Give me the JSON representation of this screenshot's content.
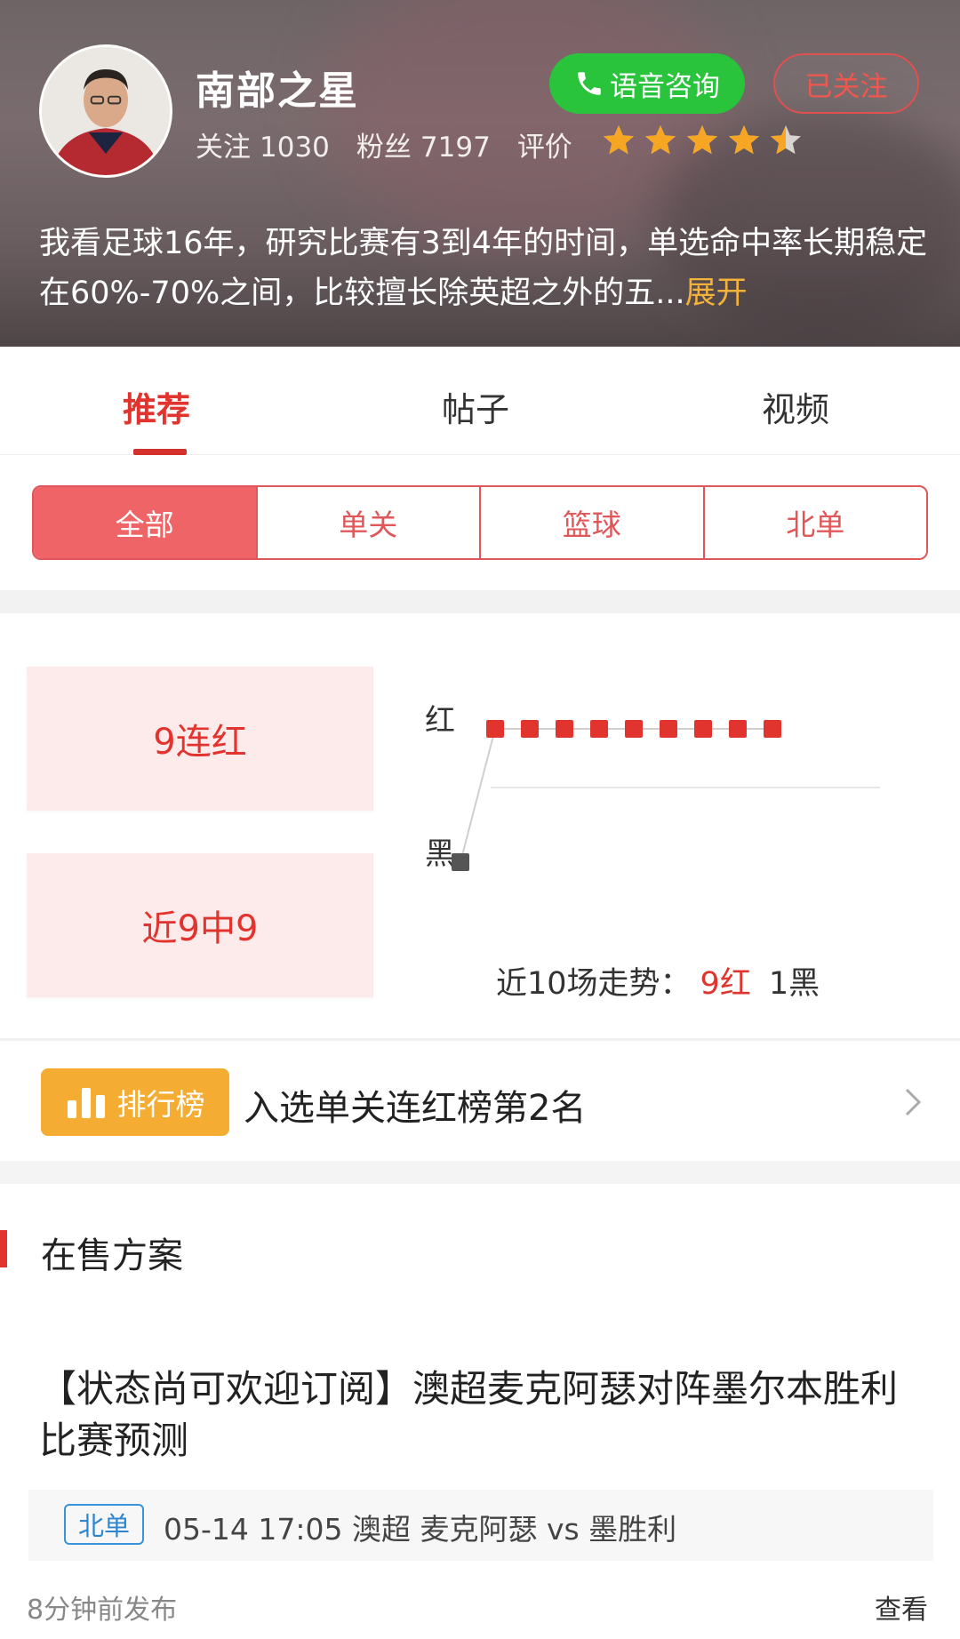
{
  "profile": {
    "name": "南部之星",
    "follow_label": "关注",
    "follow_count": "1030",
    "fans_label": "粉丝",
    "fans_count": "7197",
    "rating_label": "评价",
    "rating": 4.5,
    "voice_button": "语音咨询",
    "followed_button": "已关注",
    "bio": "我看足球16年，研究比赛有3到4年的时间，单选命中率长期稳定在60%-70%之间，比较擅长除英超之外的五...",
    "expand": "展开"
  },
  "tabs": [
    "推荐",
    "帖子",
    "视频"
  ],
  "filters": [
    "全部",
    "单关",
    "篮球",
    "北单"
  ],
  "stats": {
    "streak": "9连红",
    "recent": "近9中9",
    "label_red": "红",
    "label_black": "黑",
    "trend_prefix": "近10场走势：",
    "trend_red": "9红",
    "trend_black": "1黑"
  },
  "chart_data": {
    "type": "line",
    "x": [
      1,
      2,
      3,
      4,
      5,
      6,
      7,
      8,
      9,
      10
    ],
    "values": [
      "黑",
      "红",
      "红",
      "红",
      "红",
      "红",
      "红",
      "红",
      "红",
      "红"
    ],
    "y_categories": [
      "红",
      "黑"
    ],
    "colors": {
      "red": "#e2342f",
      "black": "#555555"
    }
  },
  "ranking": {
    "badge": "排行榜",
    "text": "入选单关连红榜第2名"
  },
  "on_sale": {
    "section_title": "在售方案",
    "plan_title": "【状态尚可欢迎订阅】澳超麦克阿瑟对阵墨尔本胜利比赛预测",
    "match_tag": "北单",
    "match_info": "05-14 17:05 澳超  麦克阿瑟  vs  墨胜利",
    "post_time": "8分钟前发布",
    "view": "查看"
  }
}
